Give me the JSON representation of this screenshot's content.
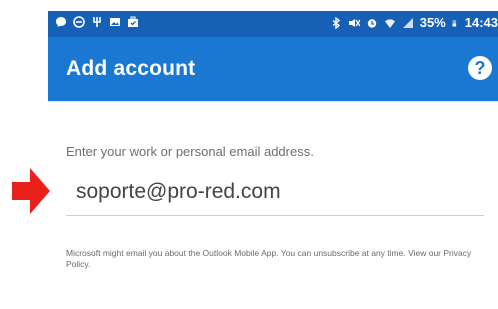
{
  "statusbar": {
    "battery": "35%",
    "time": "14:43",
    "icons_left": [
      "messenger-icon",
      "do-not-disturb-icon",
      "usb-icon",
      "gallery-icon",
      "briefcase-icon"
    ],
    "icons_right": [
      "bluetooth-icon",
      "mute-icon",
      "alarm-icon",
      "wifi-icon",
      "signal-icon",
      "battery-icon"
    ]
  },
  "appbar": {
    "title": "Add account",
    "help_label": "?"
  },
  "form": {
    "prompt": "Enter your work or personal email address.",
    "email_value": "soporte@pro-red.com"
  },
  "disclaimer": "Microsoft might email you about the Outlook Mobile App. You can unsubscribe at any time. View our Privacy Policy.",
  "colors": {
    "statusbar": "#1660b6",
    "appbar": "#1a78d3",
    "arrow": "#e8211b"
  }
}
